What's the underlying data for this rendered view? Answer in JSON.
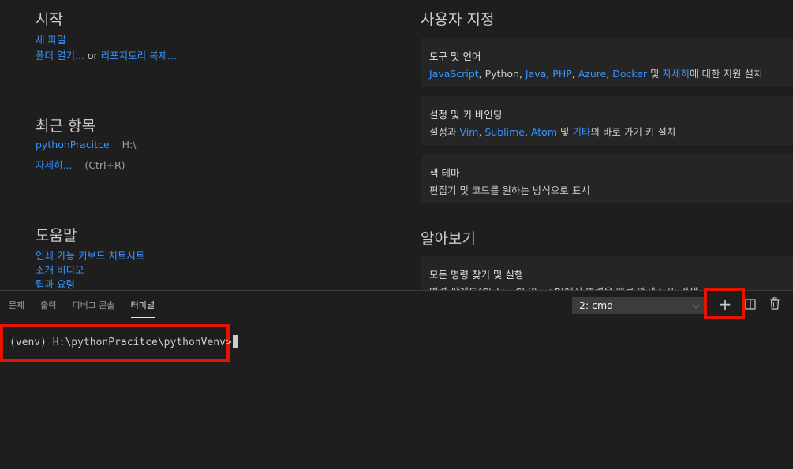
{
  "welcome": {
    "start": {
      "heading": "시작",
      "new_file": "새 파일",
      "open_folder": "폴더 열기...",
      "or": "or",
      "clone_repo": "리포지토리 복제..."
    },
    "recent": {
      "heading": "최근 항목",
      "items": [
        {
          "name": "pythonPracitce",
          "path": "H:\\"
        }
      ],
      "more": "자세히...",
      "more_shortcut": "(Ctrl+R)"
    },
    "help": {
      "heading": "도움말",
      "links": [
        "인쇄 가능 키보드 치트시트",
        "소개 비디오",
        "팁과 요령"
      ]
    },
    "customize": {
      "heading": "사용자 지정",
      "tools": {
        "title": "도구 및 언어",
        "javascript": "JavaScript",
        "python": "Python,",
        "java": "Java",
        "php": "PHP",
        "azure": "Azure",
        "docker": "Docker",
        "and": "및",
        "more": "자세히",
        "suffix": "에 대한 지원 설치"
      },
      "keymaps": {
        "title": "설정 및 키 바인딩",
        "prefix": "설정과",
        "vim": "Vim",
        "sublime": "Sublime",
        "atom": "Atom",
        "and": "및",
        "other": "기타",
        "suffix": "의 바로 가기 키 설치"
      },
      "theme": {
        "title": "색 테마",
        "desc": "편집기 및 코드를 원하는 방식으로 표시"
      }
    },
    "learn": {
      "heading": "알아보기",
      "commands": {
        "title": "모든 명령 찾기 및 실행",
        "desc": "명령 팔레트(Ctrl+<Shift>+P)에서 명령을 빠른 액세스 및 검색"
      }
    }
  },
  "panel": {
    "tabs": [
      "문제",
      "출력",
      "디버그 콘솔",
      "터미널"
    ],
    "active_tab": "터미널",
    "terminal_select": "2: cmd",
    "terminal_prompt": "(venv) H:\\pythonPracitce\\pythonVenv>"
  },
  "colors": {
    "link": "#3794ff",
    "highlight": "#e51400",
    "background": "#1e1e1e"
  }
}
